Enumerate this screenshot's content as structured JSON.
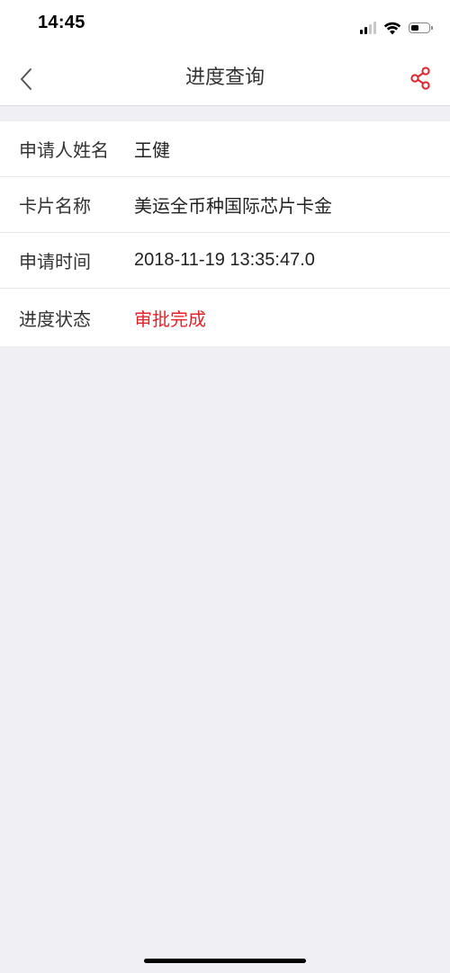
{
  "status_bar": {
    "time": "14:45",
    "signal_icon": "cellular-signal-icon",
    "wifi_icon": "wifi-icon",
    "battery_icon": "battery-icon",
    "battery_level": 0.4
  },
  "nav": {
    "title": "进度查询",
    "back_icon": "chevron-left-icon",
    "share_icon": "share-icon",
    "accent_color": "#e4242b"
  },
  "details": [
    {
      "label": "申请人姓名",
      "value": "王健"
    },
    {
      "label": "卡片名称",
      "value": "美运全币种国际芯片卡金"
    },
    {
      "label": "申请时间",
      "value": "2018-11-19 13:35:47.0"
    },
    {
      "label": "进度状态",
      "value": "审批完成"
    }
  ],
  "colors": {
    "background": "#efeff4",
    "status_text": "#e4242b"
  }
}
